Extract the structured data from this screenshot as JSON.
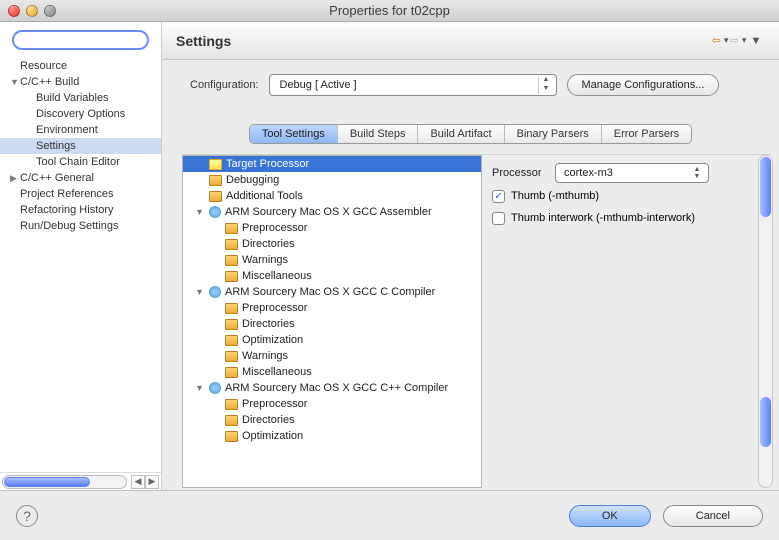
{
  "window": {
    "title": "Properties for t02cpp"
  },
  "sidebar": {
    "filter_placeholder": "",
    "items": [
      {
        "label": "Resource",
        "level": "top",
        "arrow": ""
      },
      {
        "label": "C/C++ Build",
        "level": "top",
        "arrow": "▼"
      },
      {
        "label": "Build Variables",
        "level": "sub",
        "arrow": ""
      },
      {
        "label": "Discovery Options",
        "level": "sub",
        "arrow": ""
      },
      {
        "label": "Environment",
        "level": "sub",
        "arrow": ""
      },
      {
        "label": "Settings",
        "level": "sub",
        "arrow": "",
        "selected": true
      },
      {
        "label": "Tool Chain Editor",
        "level": "sub",
        "arrow": ""
      },
      {
        "label": "C/C++ General",
        "level": "top",
        "arrow": "▶"
      },
      {
        "label": "Project References",
        "level": "top",
        "arrow": ""
      },
      {
        "label": "Refactoring History",
        "level": "top",
        "arrow": ""
      },
      {
        "label": "Run/Debug Settings",
        "level": "top",
        "arrow": ""
      }
    ]
  },
  "header": {
    "title": "Settings"
  },
  "config": {
    "label": "Configuration:",
    "value": "Debug  [ Active ]",
    "manage_button": "Manage Configurations..."
  },
  "tabs": [
    {
      "label": "Tool Settings",
      "selected": true
    },
    {
      "label": "Build Steps"
    },
    {
      "label": "Build Artifact"
    },
    {
      "label": "Binary Parsers"
    },
    {
      "label": "Error Parsers"
    }
  ],
  "tree": [
    {
      "label": "Target Processor",
      "indent": 1,
      "icon": "folder",
      "arrow": "none",
      "selected": true
    },
    {
      "label": "Debugging",
      "indent": 1,
      "icon": "folder",
      "arrow": "none"
    },
    {
      "label": "Additional Tools",
      "indent": 1,
      "icon": "folder",
      "arrow": "none"
    },
    {
      "label": "ARM Sourcery Mac OS X GCC Assembler",
      "indent": 1,
      "icon": "gear",
      "arrow": "▼"
    },
    {
      "label": "Preprocessor",
      "indent": 2,
      "icon": "folder",
      "arrow": "none"
    },
    {
      "label": "Directories",
      "indent": 2,
      "icon": "folder",
      "arrow": "none"
    },
    {
      "label": "Warnings",
      "indent": 2,
      "icon": "folder",
      "arrow": "none"
    },
    {
      "label": "Miscellaneous",
      "indent": 2,
      "icon": "folder",
      "arrow": "none"
    },
    {
      "label": "ARM Sourcery Mac OS X GCC C Compiler",
      "indent": 1,
      "icon": "gear",
      "arrow": "▼"
    },
    {
      "label": "Preprocessor",
      "indent": 2,
      "icon": "folder",
      "arrow": "none"
    },
    {
      "label": "Directories",
      "indent": 2,
      "icon": "folder",
      "arrow": "none"
    },
    {
      "label": "Optimization",
      "indent": 2,
      "icon": "folder",
      "arrow": "none"
    },
    {
      "label": "Warnings",
      "indent": 2,
      "icon": "folder",
      "arrow": "none"
    },
    {
      "label": "Miscellaneous",
      "indent": 2,
      "icon": "folder",
      "arrow": "none"
    },
    {
      "label": "ARM Sourcery Mac OS X GCC C++ Compiler",
      "indent": 1,
      "icon": "gear",
      "arrow": "▼"
    },
    {
      "label": "Preprocessor",
      "indent": 2,
      "icon": "folder",
      "arrow": "none"
    },
    {
      "label": "Directories",
      "indent": 2,
      "icon": "folder",
      "arrow": "none"
    },
    {
      "label": "Optimization",
      "indent": 2,
      "icon": "folder",
      "arrow": "none"
    }
  ],
  "props": {
    "processor_label": "Processor",
    "processor_value": "cortex-m3",
    "thumb_label": "Thumb (-mthumb)",
    "thumb_checked": true,
    "interwork_label": "Thumb interwork (-mthumb-interwork)",
    "interwork_checked": false
  },
  "footer": {
    "ok": "OK",
    "cancel": "Cancel"
  }
}
